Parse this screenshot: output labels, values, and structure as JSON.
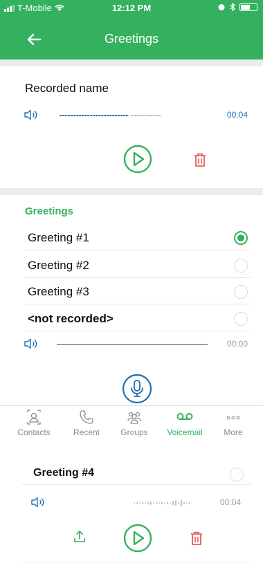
{
  "status_bar": {
    "carrier": "T-Mobile",
    "time": "12:12 PM"
  },
  "header": {
    "title": "Greetings",
    "back_icon": "arrow-left-icon"
  },
  "recorded_name": {
    "title": "Recorded name",
    "duration": "00:04",
    "play_icon": "play-icon",
    "delete_icon": "trash-icon"
  },
  "greetings": {
    "section_label": "Greetings",
    "items": [
      {
        "label": "Greeting #1",
        "selected": true
      },
      {
        "label": "Greeting #2",
        "selected": false
      },
      {
        "label": "Greeting #3",
        "selected": false
      },
      {
        "label": "<not recorded>",
        "selected": false
      }
    ],
    "player_time": "00:00",
    "record_icon": "microphone-icon"
  },
  "tabbar": {
    "items": [
      {
        "label": "Contacts",
        "icon": "contacts-icon",
        "active": false
      },
      {
        "label": "Recent",
        "icon": "phone-icon",
        "active": false
      },
      {
        "label": "Groups",
        "icon": "groups-icon",
        "active": false
      },
      {
        "label": "Voicemail",
        "icon": "voicemail-icon",
        "active": true
      },
      {
        "label": "More",
        "icon": "more-icon",
        "active": false
      }
    ]
  },
  "greeting4_card": {
    "title": "Greeting #4",
    "duration": "00:04",
    "share_icon": "share-icon",
    "play_icon": "play-icon",
    "delete_icon": "trash-icon"
  },
  "colors": {
    "accent": "#34b15e",
    "blue": "#1a6fb5",
    "danger": "#e0483e"
  }
}
